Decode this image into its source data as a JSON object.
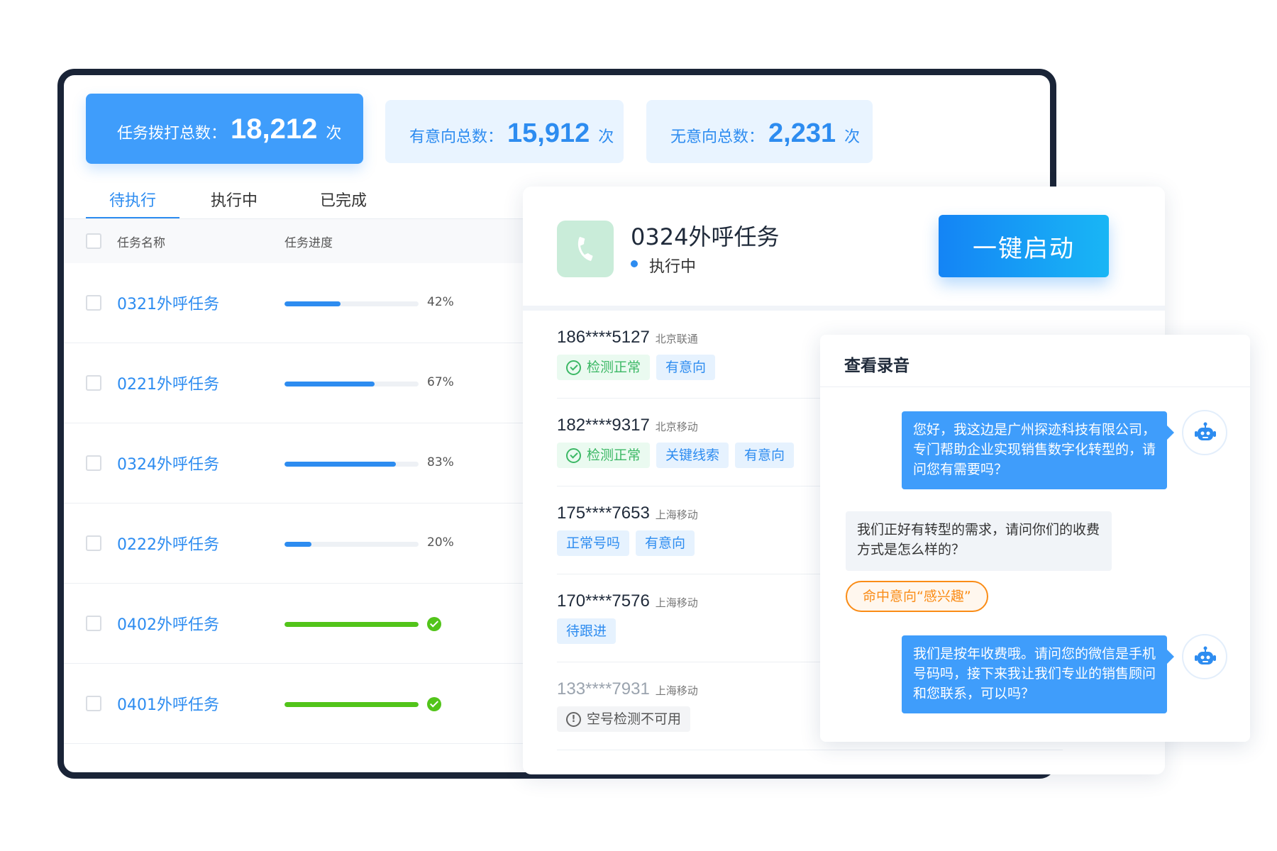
{
  "stats": [
    {
      "label": "任务拨打总数：",
      "value": "18,212",
      "unit": "次"
    },
    {
      "label": "有意向总数：",
      "value": "15,912",
      "unit": "次"
    },
    {
      "label": "无意向总数：",
      "value": "2,231",
      "unit": "次"
    }
  ],
  "tabs": [
    "待执行",
    "执行中",
    "已完成"
  ],
  "table": {
    "headers": {
      "name": "任务名称",
      "progress": "任务进度"
    },
    "rows": [
      {
        "name": "0321外呼任务",
        "progress": 42,
        "label": "42%",
        "done": false
      },
      {
        "name": "0221外呼任务",
        "progress": 67,
        "label": "67%",
        "done": false
      },
      {
        "name": "0324外呼任务",
        "progress": 83,
        "label": "83%",
        "done": false
      },
      {
        "name": "0222外呼任务",
        "progress": 20,
        "label": "20%",
        "done": false
      },
      {
        "name": "0402外呼任务",
        "progress": 100,
        "label": "",
        "done": true
      },
      {
        "name": "0401外呼任务",
        "progress": 100,
        "label": "",
        "done": true
      }
    ]
  },
  "detail": {
    "title": "0324外呼任务",
    "status": "执行中",
    "start_button": "一键启动",
    "calls": [
      {
        "number": "186****5127",
        "carrier": "北京联通",
        "tags": [
          {
            "text": "检测正常",
            "type": "ok"
          },
          {
            "text": "有意向",
            "type": "info"
          }
        ]
      },
      {
        "number": "182****9317",
        "carrier": "北京移动",
        "tags": [
          {
            "text": "检测正常",
            "type": "ok"
          },
          {
            "text": "关键线索",
            "type": "info"
          },
          {
            "text": "有意向",
            "type": "info"
          }
        ]
      },
      {
        "number": "175****7653",
        "carrier": "上海移动",
        "tags": [
          {
            "text": "正常号吗",
            "type": "info"
          },
          {
            "text": "有意向",
            "type": "info"
          }
        ]
      },
      {
        "number": "170****7576",
        "carrier": "上海移动",
        "tags": [
          {
            "text": "待跟进",
            "type": "info"
          }
        ]
      },
      {
        "number": "133****7931",
        "carrier": "上海移动",
        "tags": [
          {
            "text": "空号检测不可用",
            "type": "muted"
          }
        ],
        "disabled": true
      }
    ]
  },
  "recording": {
    "title": "查看录音",
    "messages": [
      {
        "role": "bot",
        "text": "您好，我这边是广州探迹科技有限公司，专门帮助企业实现销售数字化转型的，请问您有需要吗？"
      },
      {
        "role": "user",
        "text": "我们正好有转型的需求，请问你们的收费方式是怎么样的？"
      },
      {
        "role": "bot",
        "text": "我们是按年收费哦。请问您的微信是手机号码吗，接下来我让我们专业的销售顾问和您联系，可以吗？"
      }
    ],
    "hit_tag": "命中意向“感兴趣”"
  },
  "colors": {
    "primary": "#3f9dfb",
    "link": "#2d8cf0",
    "success": "#52c41a",
    "warning": "#fa8c16",
    "frame": "#1a2437"
  }
}
